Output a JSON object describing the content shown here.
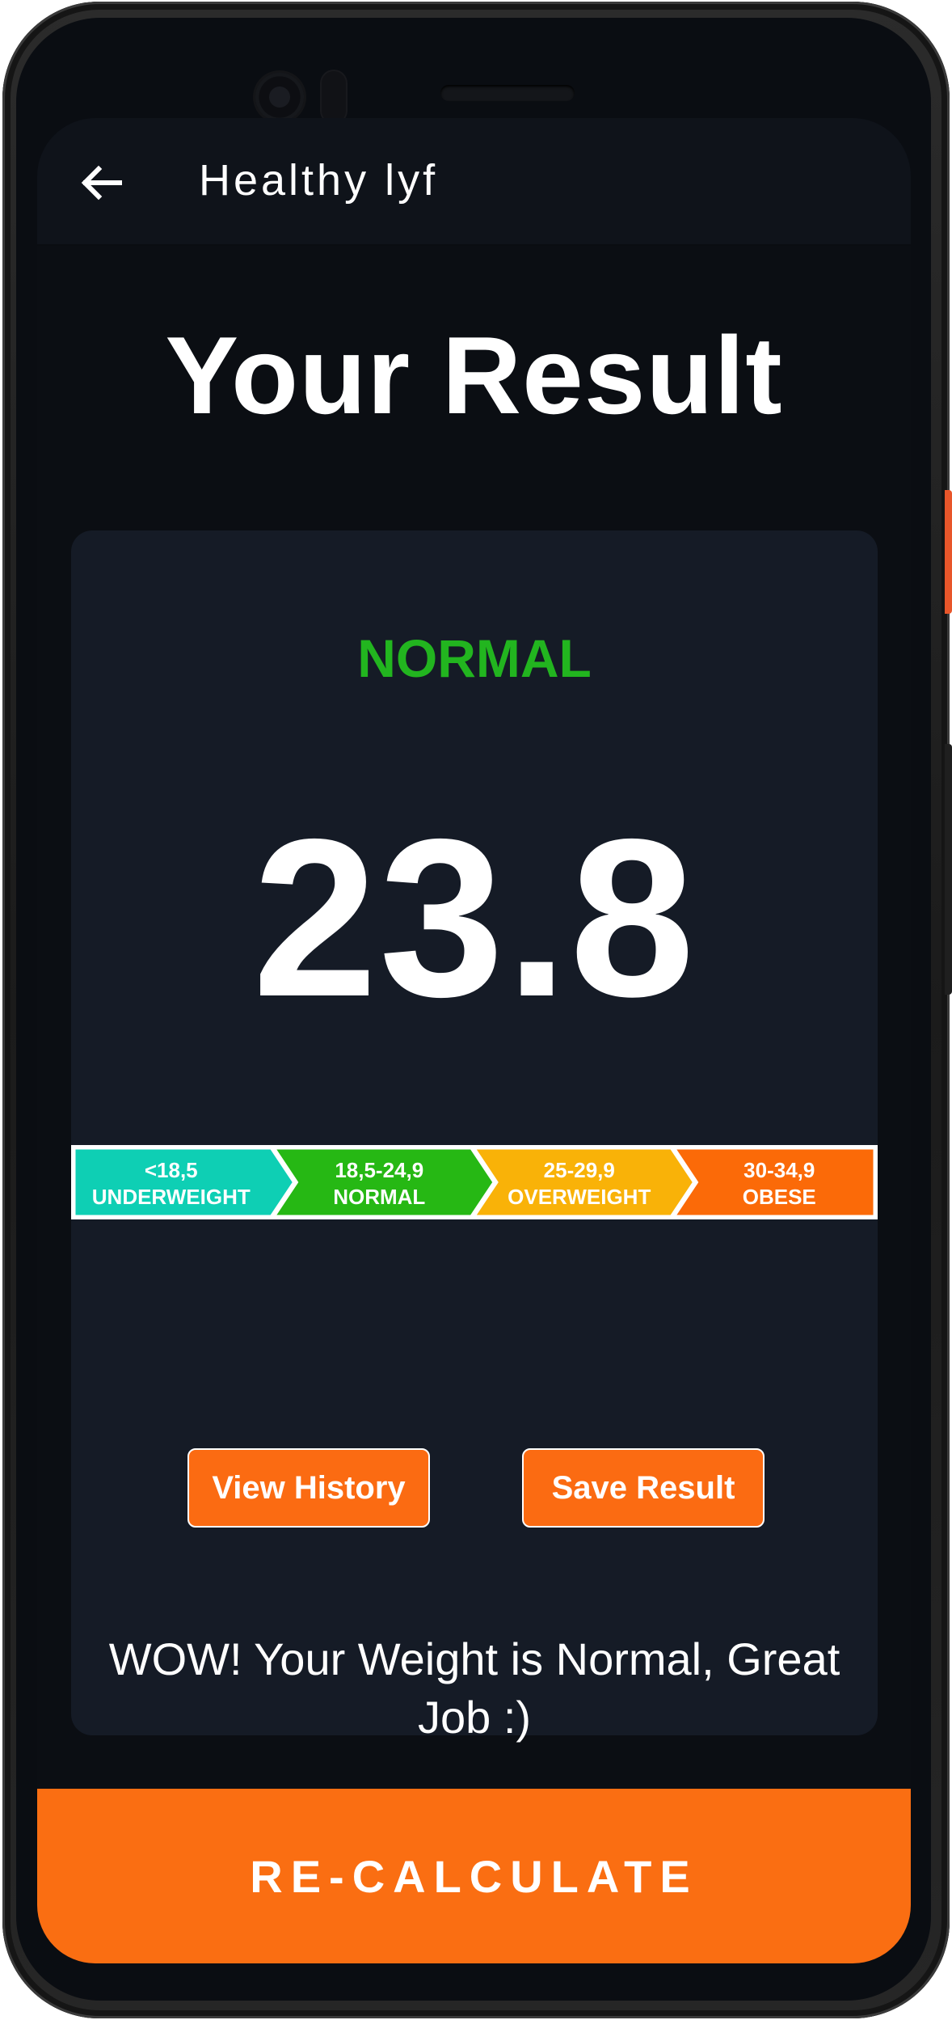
{
  "app_bar": {
    "back_icon": "arrow-left-icon",
    "title": "Healthy lyf"
  },
  "page": {
    "title": "Your Result"
  },
  "result": {
    "status": "NORMAL",
    "status_color": "#22b51f",
    "bmi": "23.8",
    "message": "WOW! Your Weight is Normal, Great Job :)"
  },
  "bmi_scale": [
    {
      "range": "<18,5",
      "label": "UNDERWEIGHT",
      "color": "#0ecfb4"
    },
    {
      "range": "18,5-24,9",
      "label": "NORMAL",
      "color": "#26b814"
    },
    {
      "range": "25-29,9",
      "label": "OVERWEIGHT",
      "color": "#f9b208"
    },
    {
      "range": "30-34,9",
      "label": "OBESE",
      "color": "#fb6a08"
    }
  ],
  "buttons": {
    "view_history": "View History",
    "save_result": "Save Result",
    "recalculate": "RE-CALCULATE",
    "accent_color": "#fa6e12"
  }
}
